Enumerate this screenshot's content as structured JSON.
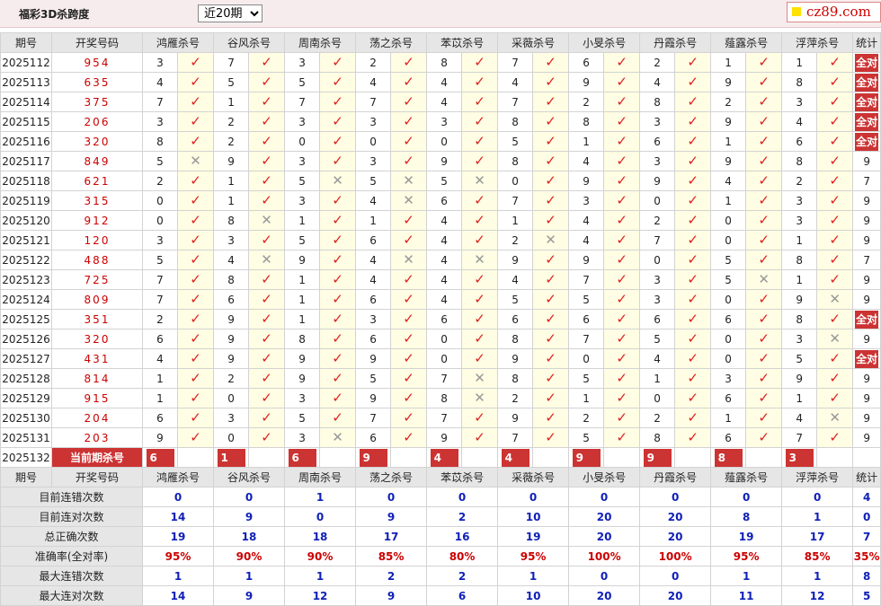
{
  "toolbar": {
    "title": "福彩3D杀跨度",
    "select_value": "近20期"
  },
  "logo": {
    "text": "cz89.com"
  },
  "headers": {
    "period": "期号",
    "draw": "开奖号码",
    "experts": [
      "鸿雁杀号",
      "谷风杀号",
      "周南杀号",
      "荡之杀号",
      "苯苡杀号",
      "采薇杀号",
      "小旻杀号",
      "丹霞杀号",
      "薤露杀号",
      "浮萍杀号"
    ],
    "stat": "统计"
  },
  "rows": [
    {
      "period": "2025112",
      "draw": "954",
      "vals": [
        "3",
        "7",
        "3",
        "2",
        "8",
        "7",
        "6",
        "2",
        "1",
        "1"
      ],
      "hits": [
        1,
        1,
        1,
        1,
        1,
        1,
        1,
        1,
        1,
        1
      ],
      "stat": "全对"
    },
    {
      "period": "2025113",
      "draw": "635",
      "vals": [
        "4",
        "5",
        "5",
        "4",
        "4",
        "4",
        "9",
        "4",
        "9",
        "8"
      ],
      "hits": [
        1,
        1,
        1,
        1,
        1,
        1,
        1,
        1,
        1,
        1
      ],
      "stat": "全对"
    },
    {
      "period": "2025114",
      "draw": "375",
      "vals": [
        "7",
        "1",
        "7",
        "7",
        "4",
        "7",
        "2",
        "8",
        "2",
        "3"
      ],
      "hits": [
        1,
        1,
        1,
        1,
        1,
        1,
        1,
        1,
        1,
        1
      ],
      "stat": "全对"
    },
    {
      "period": "2025115",
      "draw": "206",
      "vals": [
        "3",
        "2",
        "3",
        "3",
        "3",
        "8",
        "8",
        "3",
        "9",
        "4"
      ],
      "hits": [
        1,
        1,
        1,
        1,
        1,
        1,
        1,
        1,
        1,
        1
      ],
      "stat": "全对"
    },
    {
      "period": "2025116",
      "draw": "320",
      "vals": [
        "8",
        "2",
        "0",
        "0",
        "0",
        "5",
        "1",
        "6",
        "1",
        "6"
      ],
      "hits": [
        1,
        1,
        1,
        1,
        1,
        1,
        1,
        1,
        1,
        1
      ],
      "stat": "全对"
    },
    {
      "period": "2025117",
      "draw": "849",
      "vals": [
        "5",
        "9",
        "3",
        "3",
        "9",
        "8",
        "4",
        "3",
        "9",
        "8"
      ],
      "hits": [
        0,
        1,
        1,
        1,
        1,
        1,
        1,
        1,
        1,
        1
      ],
      "stat": "9"
    },
    {
      "period": "2025118",
      "draw": "621",
      "vals": [
        "2",
        "1",
        "5",
        "5",
        "5",
        "0",
        "9",
        "9",
        "4",
        "2"
      ],
      "hits": [
        1,
        1,
        0,
        0,
        0,
        1,
        1,
        1,
        1,
        1
      ],
      "stat": "7"
    },
    {
      "period": "2025119",
      "draw": "315",
      "vals": [
        "0",
        "1",
        "3",
        "4",
        "6",
        "7",
        "3",
        "0",
        "1",
        "3"
      ],
      "hits": [
        1,
        1,
        1,
        0,
        1,
        1,
        1,
        1,
        1,
        1
      ],
      "stat": "9"
    },
    {
      "period": "2025120",
      "draw": "912",
      "vals": [
        "0",
        "8",
        "1",
        "1",
        "4",
        "1",
        "4",
        "2",
        "0",
        "3"
      ],
      "hits": [
        1,
        0,
        1,
        1,
        1,
        1,
        1,
        1,
        1,
        1
      ],
      "stat": "9"
    },
    {
      "period": "2025121",
      "draw": "120",
      "vals": [
        "3",
        "3",
        "5",
        "6",
        "4",
        "2",
        "4",
        "7",
        "0",
        "1"
      ],
      "hits": [
        1,
        1,
        1,
        1,
        1,
        0,
        1,
        1,
        1,
        1
      ],
      "stat": "9"
    },
    {
      "period": "2025122",
      "draw": "488",
      "vals": [
        "5",
        "4",
        "9",
        "4",
        "4",
        "9",
        "9",
        "0",
        "5",
        "8"
      ],
      "hits": [
        1,
        0,
        1,
        0,
        0,
        1,
        1,
        1,
        1,
        1
      ],
      "stat": "7"
    },
    {
      "period": "2025123",
      "draw": "725",
      "vals": [
        "7",
        "8",
        "1",
        "4",
        "4",
        "4",
        "7",
        "3",
        "5",
        "1"
      ],
      "hits": [
        1,
        1,
        1,
        1,
        1,
        1,
        1,
        1,
        0,
        1
      ],
      "stat": "9"
    },
    {
      "period": "2025124",
      "draw": "809",
      "vals": [
        "7",
        "6",
        "1",
        "6",
        "4",
        "5",
        "5",
        "3",
        "0",
        "9"
      ],
      "hits": [
        1,
        1,
        1,
        1,
        1,
        1,
        1,
        1,
        1,
        0
      ],
      "stat": "9"
    },
    {
      "period": "2025125",
      "draw": "351",
      "vals": [
        "2",
        "9",
        "1",
        "3",
        "6",
        "6",
        "6",
        "6",
        "6",
        "8"
      ],
      "hits": [
        1,
        1,
        1,
        1,
        1,
        1,
        1,
        1,
        1,
        1
      ],
      "stat": "全对"
    },
    {
      "period": "2025126",
      "draw": "320",
      "vals": [
        "6",
        "9",
        "8",
        "6",
        "0",
        "8",
        "7",
        "5",
        "0",
        "3"
      ],
      "hits": [
        1,
        1,
        1,
        1,
        1,
        1,
        1,
        1,
        1,
        0
      ],
      "stat": "9"
    },
    {
      "period": "2025127",
      "draw": "431",
      "vals": [
        "4",
        "9",
        "9",
        "9",
        "0",
        "9",
        "0",
        "4",
        "0",
        "5"
      ],
      "hits": [
        1,
        1,
        1,
        1,
        1,
        1,
        1,
        1,
        1,
        1
      ],
      "stat": "全对"
    },
    {
      "period": "2025128",
      "draw": "814",
      "vals": [
        "1",
        "2",
        "9",
        "5",
        "7",
        "8",
        "5",
        "1",
        "3",
        "9"
      ],
      "hits": [
        1,
        1,
        1,
        1,
        0,
        1,
        1,
        1,
        1,
        1
      ],
      "stat": "9"
    },
    {
      "period": "2025129",
      "draw": "915",
      "vals": [
        "1",
        "0",
        "3",
        "9",
        "8",
        "2",
        "1",
        "0",
        "6",
        "1"
      ],
      "hits": [
        1,
        1,
        1,
        1,
        0,
        1,
        1,
        1,
        1,
        1
      ],
      "stat": "9"
    },
    {
      "period": "2025130",
      "draw": "204",
      "vals": [
        "6",
        "3",
        "5",
        "7",
        "7",
        "9",
        "2",
        "2",
        "1",
        "4"
      ],
      "hits": [
        1,
        1,
        1,
        1,
        1,
        1,
        1,
        1,
        1,
        0
      ],
      "stat": "9"
    },
    {
      "period": "2025131",
      "draw": "203",
      "vals": [
        "9",
        "0",
        "3",
        "6",
        "9",
        "7",
        "5",
        "8",
        "6",
        "7"
      ],
      "hits": [
        1,
        1,
        0,
        1,
        1,
        1,
        1,
        1,
        1,
        1
      ],
      "stat": "9"
    }
  ],
  "current": {
    "period": "2025132",
    "label": "当前期杀号",
    "picks": [
      "6",
      "1",
      "6",
      "9",
      "4",
      "4",
      "9",
      "9",
      "8",
      "3"
    ]
  },
  "stats": [
    {
      "label": "目前连错次数",
      "vals": [
        "0",
        "0",
        "1",
        "0",
        "0",
        "0",
        "0",
        "0",
        "0",
        "0"
      ],
      "total": "4",
      "red": false
    },
    {
      "label": "目前连对次数",
      "vals": [
        "14",
        "9",
        "0",
        "9",
        "2",
        "10",
        "20",
        "20",
        "8",
        "1"
      ],
      "total": "0",
      "red": false
    },
    {
      "label": "总正确次数",
      "vals": [
        "19",
        "18",
        "18",
        "17",
        "16",
        "19",
        "20",
        "20",
        "19",
        "17"
      ],
      "total": "7",
      "red": false
    },
    {
      "label": "准确率(全对率)",
      "vals": [
        "95%",
        "90%",
        "90%",
        "85%",
        "80%",
        "95%",
        "100%",
        "100%",
        "95%",
        "85%"
      ],
      "total": "35%",
      "red": true
    },
    {
      "label": "最大连错次数",
      "vals": [
        "1",
        "1",
        "1",
        "2",
        "2",
        "1",
        "0",
        "0",
        "1",
        "1"
      ],
      "total": "8",
      "red": false
    },
    {
      "label": "最大连对次数",
      "vals": [
        "14",
        "9",
        "12",
        "9",
        "6",
        "10",
        "20",
        "20",
        "11",
        "12"
      ],
      "total": "5",
      "red": false
    }
  ]
}
